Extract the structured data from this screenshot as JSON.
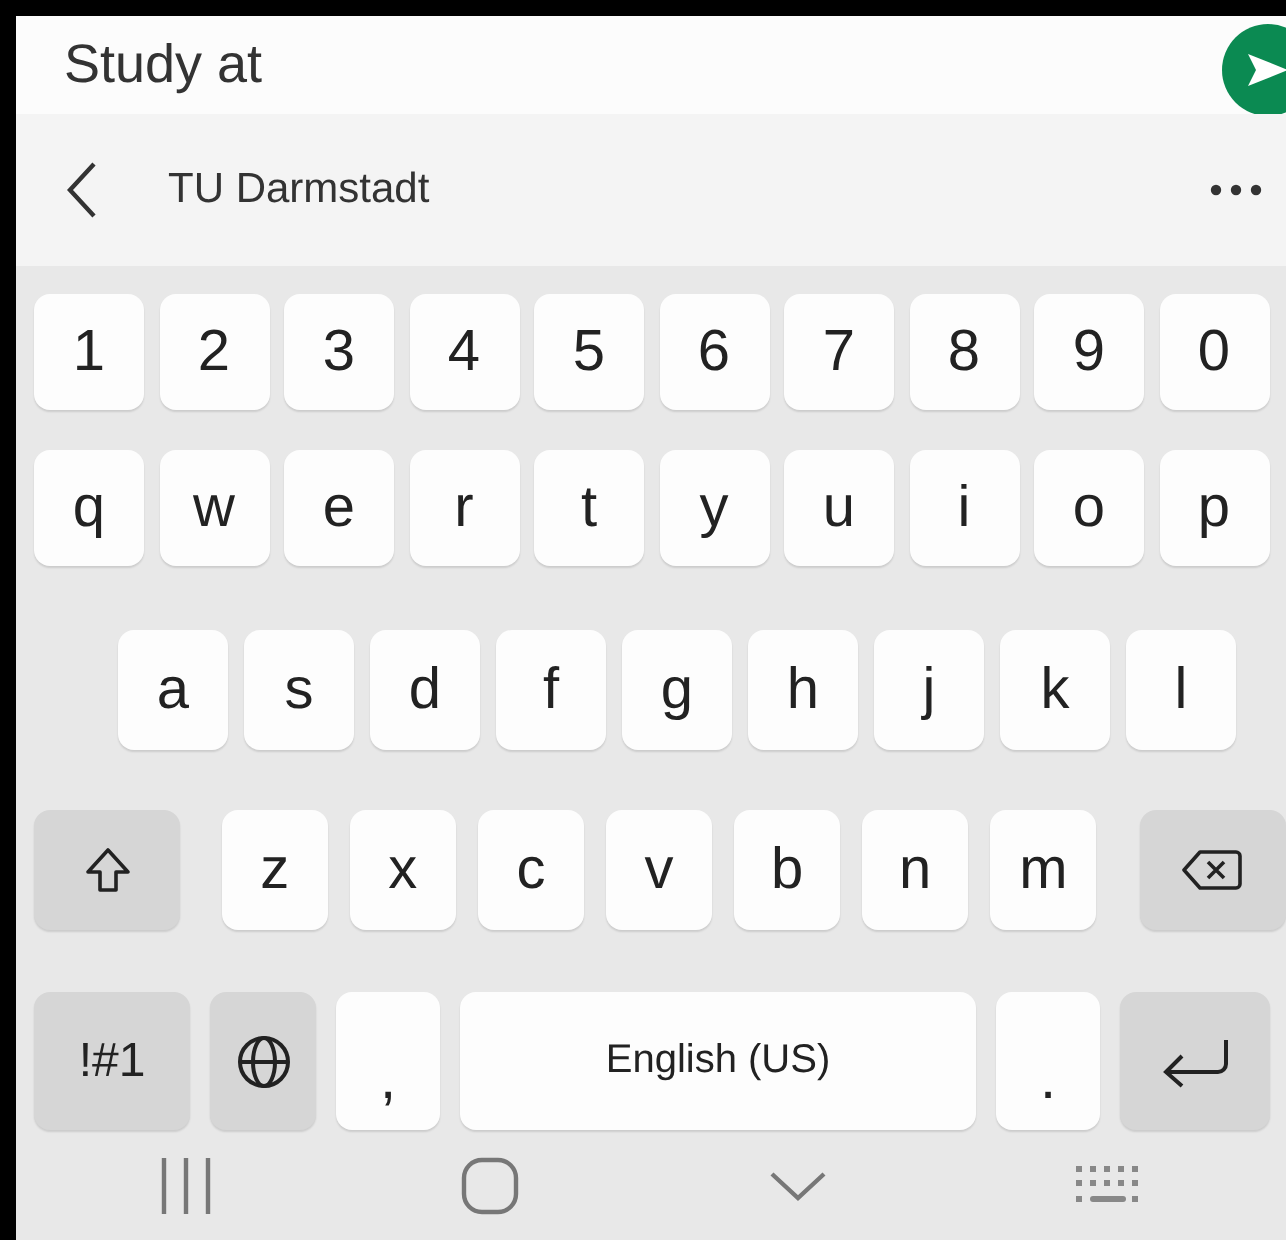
{
  "input": {
    "value": "Study at"
  },
  "suggestion_bar": {
    "suggestion": "TU Darmstadt"
  },
  "keyboard": {
    "rows": [
      {
        "keys": [
          {
            "kind": "char",
            "label": "1"
          },
          {
            "kind": "char",
            "label": "2"
          },
          {
            "kind": "char",
            "label": "3"
          },
          {
            "kind": "char",
            "label": "4"
          },
          {
            "kind": "char",
            "label": "5"
          },
          {
            "kind": "char",
            "label": "6"
          },
          {
            "kind": "char",
            "label": "7"
          },
          {
            "kind": "char",
            "label": "8"
          },
          {
            "kind": "char",
            "label": "9"
          },
          {
            "kind": "char",
            "label": "0"
          }
        ]
      },
      {
        "keys": [
          {
            "kind": "char",
            "label": "q"
          },
          {
            "kind": "char",
            "label": "w"
          },
          {
            "kind": "char",
            "label": "e"
          },
          {
            "kind": "char",
            "label": "r"
          },
          {
            "kind": "char",
            "label": "t"
          },
          {
            "kind": "char",
            "label": "y"
          },
          {
            "kind": "char",
            "label": "u"
          },
          {
            "kind": "char",
            "label": "i"
          },
          {
            "kind": "char",
            "label": "o"
          },
          {
            "kind": "char",
            "label": "p"
          }
        ]
      },
      {
        "keys": [
          {
            "kind": "char",
            "label": "a"
          },
          {
            "kind": "char",
            "label": "s"
          },
          {
            "kind": "char",
            "label": "d"
          },
          {
            "kind": "char",
            "label": "f"
          },
          {
            "kind": "char",
            "label": "g"
          },
          {
            "kind": "char",
            "label": "h"
          },
          {
            "kind": "char",
            "label": "j"
          },
          {
            "kind": "char",
            "label": "k"
          },
          {
            "kind": "char",
            "label": "l"
          }
        ]
      },
      {
        "keys": [
          {
            "kind": "shift"
          },
          {
            "kind": "char",
            "label": "z"
          },
          {
            "kind": "char",
            "label": "x"
          },
          {
            "kind": "char",
            "label": "c"
          },
          {
            "kind": "char",
            "label": "v"
          },
          {
            "kind": "char",
            "label": "b"
          },
          {
            "kind": "char",
            "label": "n"
          },
          {
            "kind": "char",
            "label": "m"
          },
          {
            "kind": "backspace"
          }
        ]
      },
      {
        "keys": [
          {
            "kind": "symbols",
            "label": "!#1"
          },
          {
            "kind": "globe"
          },
          {
            "kind": "punct",
            "label": ","
          },
          {
            "kind": "space",
            "label": "English (US)"
          },
          {
            "kind": "punct",
            "label": "."
          },
          {
            "kind": "enter"
          }
        ]
      }
    ]
  }
}
